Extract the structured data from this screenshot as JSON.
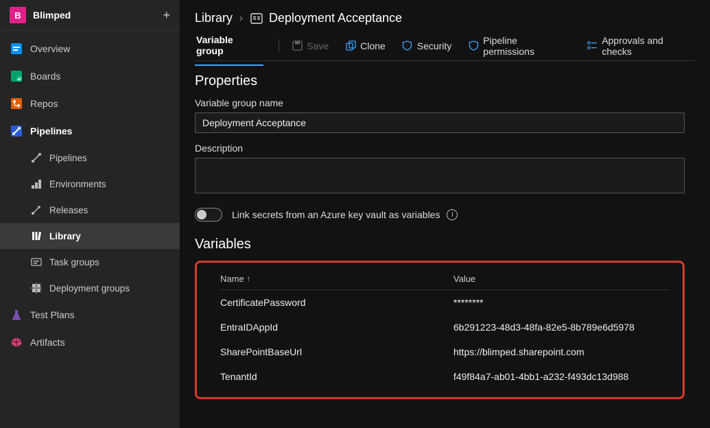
{
  "project": {
    "badge": "B",
    "name": "Blimped"
  },
  "sidebar": {
    "overview": "Overview",
    "boards": "Boards",
    "repos": "Repos",
    "pipelines": "Pipelines",
    "sub_pipelines": "Pipelines",
    "environments": "Environments",
    "releases": "Releases",
    "library": "Library",
    "task_groups": "Task groups",
    "deployment_groups": "Deployment groups",
    "test_plans": "Test Plans",
    "artifacts": "Artifacts"
  },
  "breadcrumb": {
    "root": "Library",
    "leaf": "Deployment Acceptance"
  },
  "tabs": {
    "variable_group": "Variable group"
  },
  "commands": {
    "save": "Save",
    "clone": "Clone",
    "security": "Security",
    "pipeline_permissions": "Pipeline permissions",
    "approvals": "Approvals and checks"
  },
  "properties": {
    "heading": "Properties",
    "name_label": "Variable group name",
    "name_value": "Deployment Acceptance",
    "description_label": "Description",
    "description_value": ""
  },
  "toggle": {
    "label": "Link secrets from an Azure key vault as variables"
  },
  "variables": {
    "heading": "Variables",
    "col_name": "Name",
    "col_value": "Value",
    "rows": [
      {
        "name": "CertificatePassword",
        "value": "********"
      },
      {
        "name": "EntraIDAppId",
        "value": "6b291223-48d3-48fa-82e5-8b789e6d5978"
      },
      {
        "name": "SharePointBaseUrl",
        "value": "https://blimped.sharepoint.com"
      },
      {
        "name": "TenantId",
        "value": "f49f84a7-ab01-4bb1-a232-f493dc13d988"
      }
    ]
  }
}
